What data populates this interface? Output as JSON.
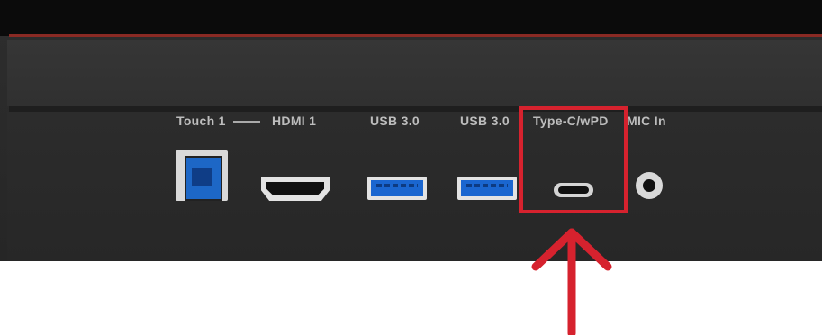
{
  "ports": {
    "touch_label": "Touch 1",
    "hdmi_label": "HDMI 1",
    "usb1_label": "USB 3.0",
    "usb2_label": "USB 3.0",
    "typec_label": "Type-C/wPD",
    "mic_label": "MIC In"
  },
  "colors": {
    "highlight": "#d6222e",
    "usb_blue": "#1a66d0",
    "panel": "#2b2b2b"
  },
  "icons": [
    "usb-b-port",
    "hdmi-port",
    "usb-a-port",
    "usb-c-port",
    "mic-jack",
    "arrow-up"
  ]
}
